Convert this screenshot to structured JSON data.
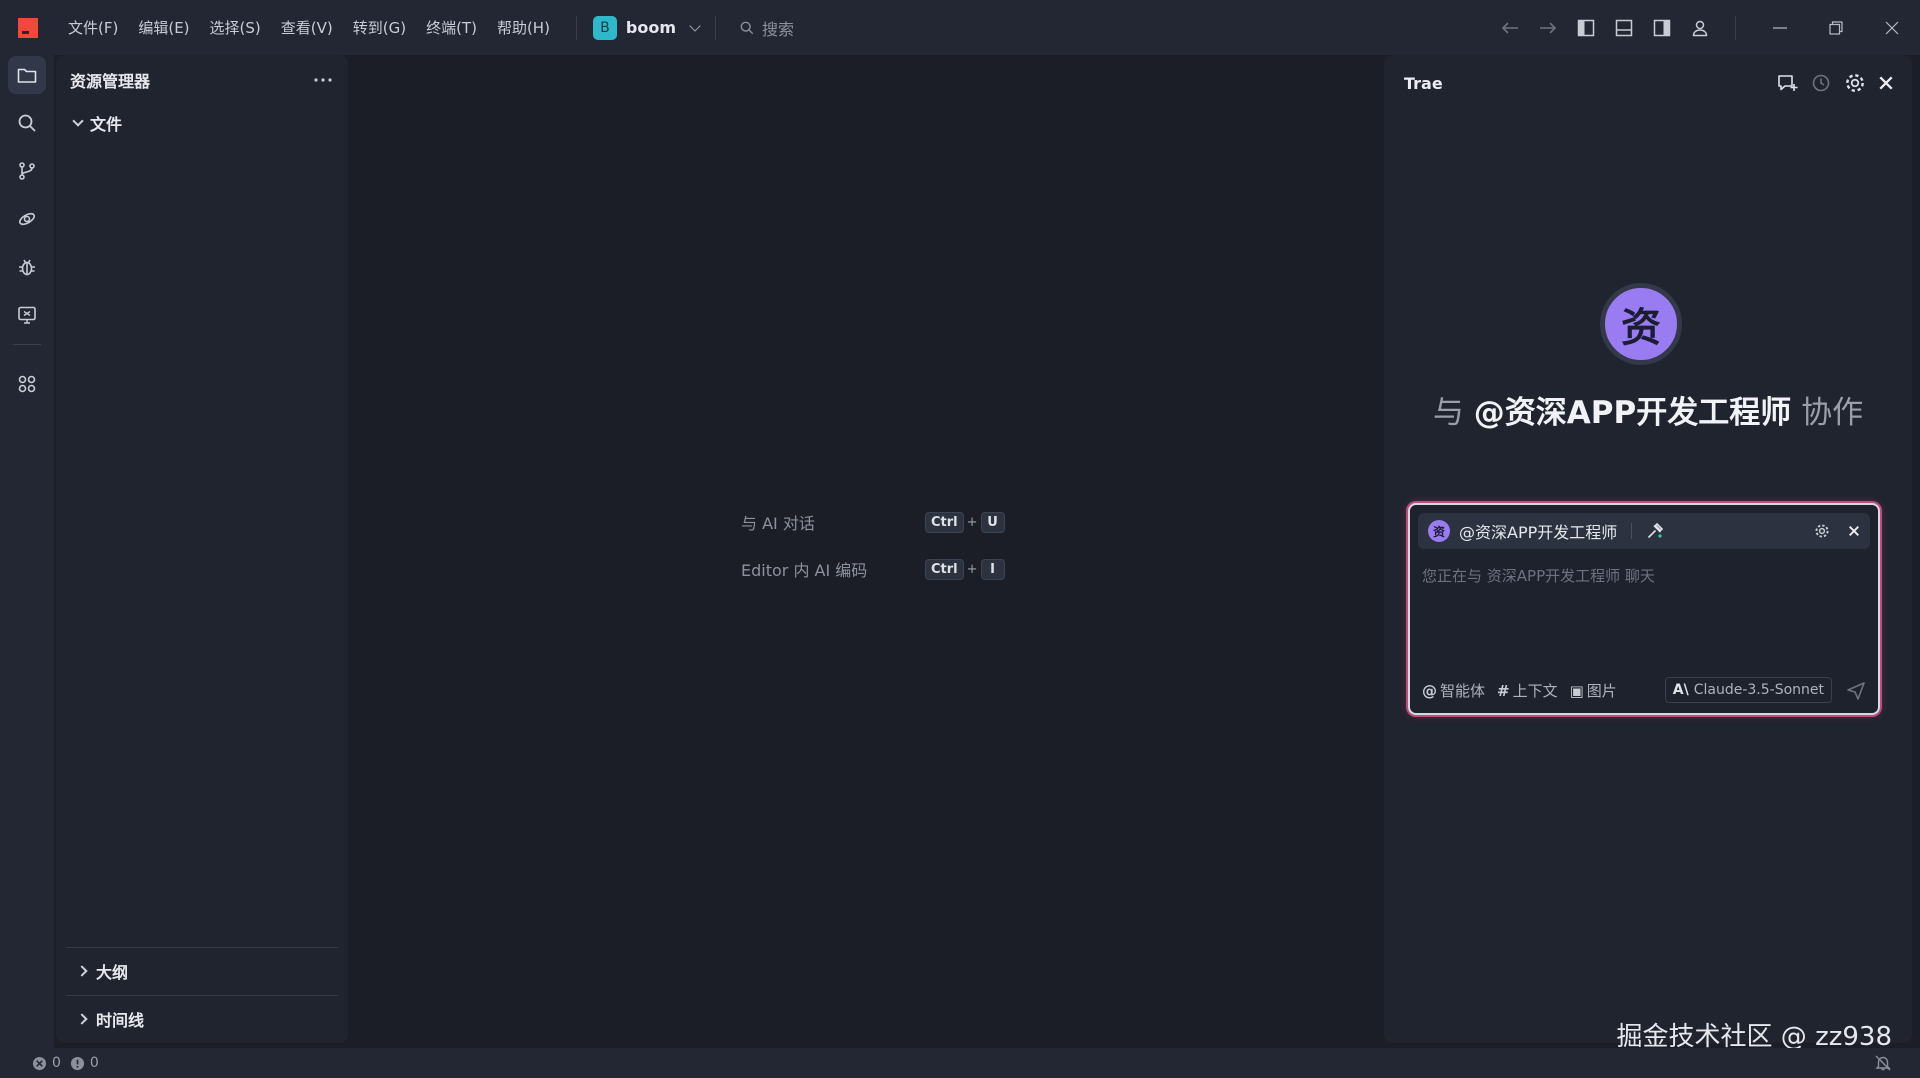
{
  "menu": [
    "文件(F)",
    "编辑(E)",
    "选择(S)",
    "查看(V)",
    "转到(G)",
    "终端(T)",
    "帮助(H)"
  ],
  "project": {
    "badge": "B",
    "name": "boom"
  },
  "search": {
    "placeholder": "搜索"
  },
  "explorer": {
    "title": "资源管理器",
    "folder": "文件",
    "sections": [
      "大纲",
      "时间线"
    ]
  },
  "editor": {
    "shortcuts": [
      {
        "label": "与 AI 对话",
        "keys": [
          "Ctrl",
          "U"
        ]
      },
      {
        "label": "Editor 内 AI 编码",
        "keys": [
          "Ctrl",
          "I"
        ]
      }
    ],
    "plus": "+"
  },
  "trae": {
    "title": "Trae",
    "avatar_char": "资",
    "collab_prefix": "与",
    "collab_agent": "@资深APP开发工程师",
    "collab_suffix": "协作",
    "chat": {
      "agent_name": "@资深APP开发工程师",
      "placeholder": "您正在与 资深APP开发工程师 聊天",
      "tools": [
        {
          "symbol": "@",
          "label": "智能体"
        },
        {
          "symbol": "#",
          "label": "上下文"
        },
        {
          "symbol": "▣",
          "label": "图片"
        }
      ],
      "model_logo": "A\\",
      "model": "Claude-3.5-Sonnet"
    }
  },
  "watermark": "掘金技术社区 @ zz938",
  "status": {
    "errors": "0",
    "warnings": "0"
  },
  "colors": {
    "accent": "#c14c7a",
    "avatar": "#9a7cf2",
    "project_badge": "#2fb8c9",
    "logo": "#f0493a"
  }
}
